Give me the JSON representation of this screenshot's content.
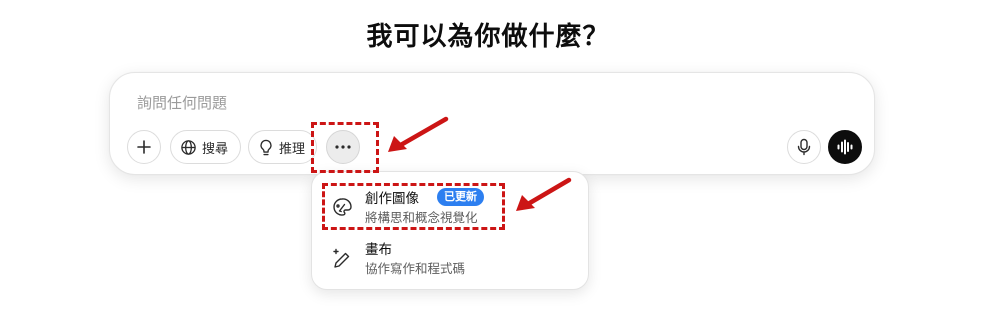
{
  "heading": "我可以為你做什麼？",
  "composer": {
    "placeholder": "詢問任何問題",
    "value": "",
    "buttons": {
      "plus_icon": "plus-icon",
      "search_label": "搜尋",
      "search_icon": "globe-icon",
      "reason_label": "推理",
      "reason_icon": "lightbulb-icon",
      "more_icon": "ellipsis-icon",
      "mic_icon": "microphone-icon",
      "voice_icon": "voice-waveform-icon"
    }
  },
  "menu": {
    "items": [
      {
        "title": "創作圖像",
        "badge": "已更新",
        "subtitle": "將構思和概念視覺化",
        "icon": "paint-palette-icon"
      },
      {
        "title": "畫布",
        "subtitle": "協作寫作和程式碼",
        "icon": "pen-sparkle-icon"
      }
    ]
  },
  "annotations": {
    "color": "#cc1515",
    "highlights": [
      "more-button",
      "create-image-item"
    ]
  },
  "colors": {
    "badge": "#2d7ff0",
    "voice_button": "#0d0d0d",
    "placeholder": "#9b9b9b"
  }
}
